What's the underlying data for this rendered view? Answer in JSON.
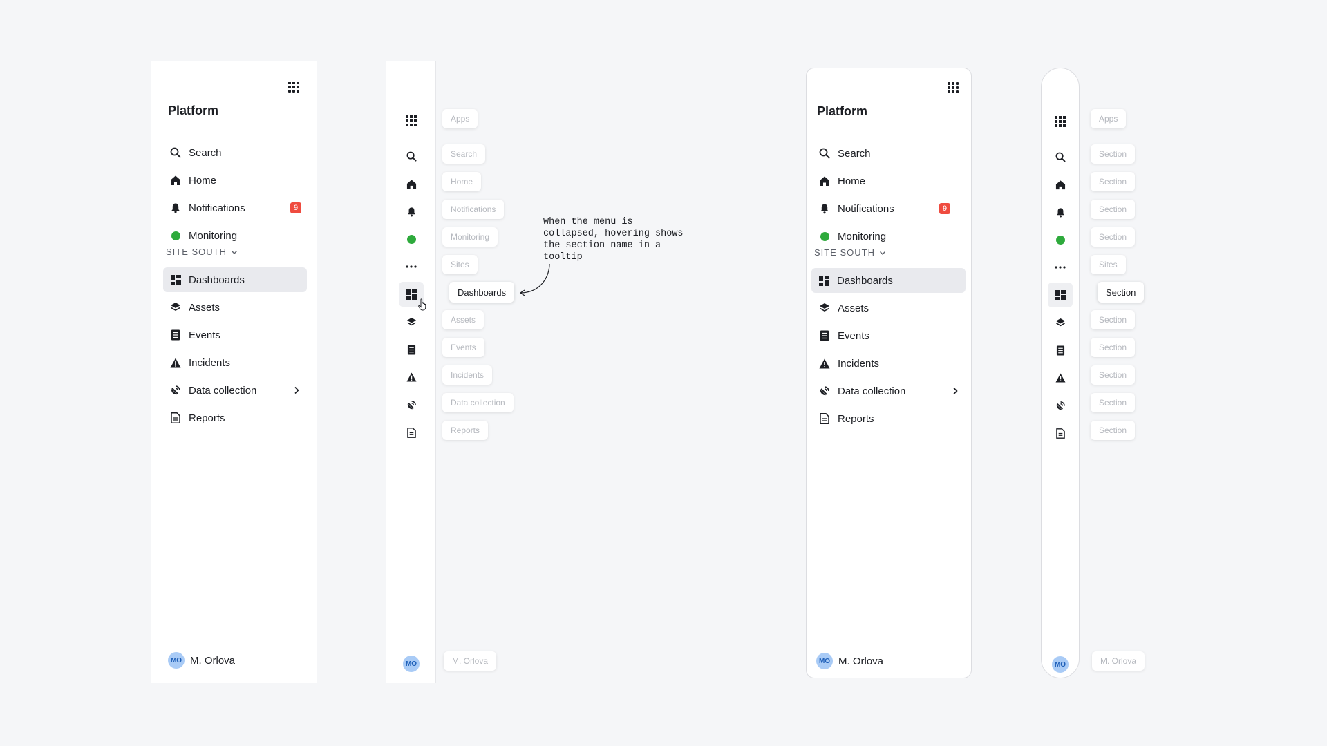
{
  "expanded_menu": {
    "title": "Platform",
    "nav_items": [
      {
        "label": "Search",
        "icon": "search-icon"
      },
      {
        "label": "Home",
        "icon": "home-icon"
      },
      {
        "label": "Notifications",
        "icon": "bell-icon",
        "badge": "9"
      },
      {
        "label": "Monitoring",
        "icon": "status-dot-icon"
      }
    ],
    "group_label": "SITE SOUTH",
    "section_items": [
      {
        "label": "Dashboards",
        "icon": "dashboard-icon",
        "active": true
      },
      {
        "label": "Assets",
        "icon": "layers-icon"
      },
      {
        "label": "Events",
        "icon": "document-list-icon"
      },
      {
        "label": "Incidents",
        "icon": "warning-icon"
      },
      {
        "label": "Data collection",
        "icon": "data-collection-icon",
        "has_submenu": true
      },
      {
        "label": "Reports",
        "icon": "report-icon"
      }
    ],
    "user": {
      "initials": "MO",
      "name": "M. Orlova"
    }
  },
  "collapsed_tooltips": {
    "apps": "Apps",
    "items": [
      "Search",
      "Home",
      "Notifications",
      "Monitoring",
      "Sites",
      "Dashboards",
      "Assets",
      "Events",
      "Incidents",
      "Data collection",
      "Reports"
    ],
    "user": "M. Orlova"
  },
  "annotation": "When the menu is\ncollapsed, hovering shows\nthe section name in a\ntooltip",
  "collapsed_placeholder_tooltips": {
    "apps": "Apps",
    "items": [
      "Section",
      "Section",
      "Section",
      "Section",
      "Sites",
      "Section",
      "Section",
      "Section",
      "Section",
      "Section",
      "Section"
    ],
    "user": "M. Orlova"
  },
  "colors": {
    "accent_status": "#2eaa3c",
    "badge": "#ef4b3f",
    "avatar_bg": "#a9cbf6",
    "active_bg": "#e9eaee"
  }
}
